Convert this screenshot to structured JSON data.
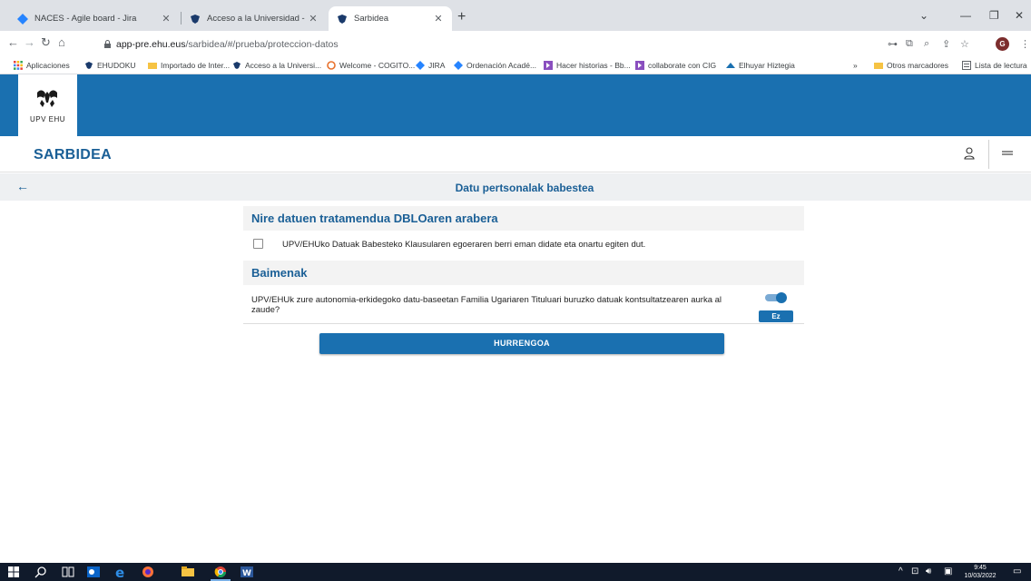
{
  "browser": {
    "tabs": [
      {
        "title": "NACES - Agile board - Jira",
        "icon": "jira-icon"
      },
      {
        "title": "Acceso a la Universidad - UPV/EH",
        "icon": "upv-icon"
      },
      {
        "title": "Sarbidea",
        "icon": "upv-icon",
        "active": true
      }
    ],
    "new_tab": "+",
    "url_host": "app-pre.ehu.eus",
    "url_path": "/sarbidea/#/prueba/proteccion-datos",
    "bookmarks": [
      {
        "label": "Aplicaciones",
        "icon": "apps-grid-icon"
      },
      {
        "label": "EHUDOKU",
        "icon": "upv-icon"
      },
      {
        "label": "Importado de Inter...",
        "icon": "folder-icon"
      },
      {
        "label": "Acceso a la Universi...",
        "icon": "upv-icon"
      },
      {
        "label": "Welcome - COGITO...",
        "icon": "cogito-icon"
      },
      {
        "label": "JIRA",
        "icon": "jira-icon"
      },
      {
        "label": "Ordenación Acadé...",
        "icon": "jira-icon"
      },
      {
        "label": "Hacer historias - Bb...",
        "icon": "bb-icon"
      },
      {
        "label": "collaborate con CIG",
        "icon": "bb-icon"
      },
      {
        "label": "Elhuyar Hiztegia",
        "icon": "elhuyar-icon"
      },
      {
        "label": "»",
        "icon": ""
      },
      {
        "label": "Otros marcadores",
        "icon": "folder-icon"
      },
      {
        "label": "Lista de lectura",
        "icon": "reading-list-icon"
      }
    ],
    "profile_initial": "G"
  },
  "app": {
    "logo_text": "UPV EHU",
    "title": "SARBIDEA",
    "page_title": "Datu pertsonalak babestea",
    "section1_title": "Nire datuen tratamendua DBLOaren arabera",
    "consent_text": "UPV/EHUko Datuak Babesteko Klausularen egoeraren berri eman didate eta onartu egiten dut.",
    "section2_title": "Baimenak",
    "permission_text": "UPV/EHUk zure autonomia-erkidegoko datu-baseetan Familia Ugariaren Tituluari buruzko datuak kontsultatzearen aurka al zaude?",
    "permission_value": "Ez",
    "next_button": "HURRENGOA"
  },
  "taskbar": {
    "time": "9:45",
    "date": "10/03/2022"
  },
  "colors": {
    "primary": "#1a70b0",
    "title": "#1a5f96",
    "section_bg": "#f3f3f3"
  }
}
